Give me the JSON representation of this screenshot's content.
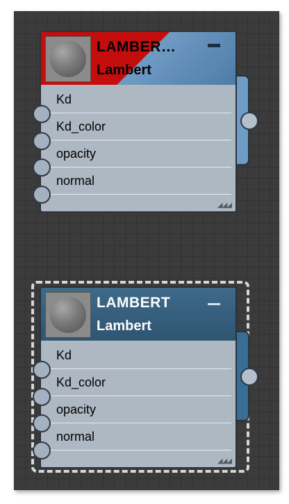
{
  "nodes": [
    {
      "title": "LAMBER…",
      "subtitle": "Lambert",
      "inputs": [
        "Kd",
        "Kd_color",
        "opacity",
        "normal"
      ],
      "selected": false,
      "header_color": "#c40d0d"
    },
    {
      "title": "LAMBERT",
      "subtitle": "Lambert",
      "inputs": [
        "Kd",
        "Kd_color",
        "opacity",
        "normal"
      ],
      "selected": true,
      "header_color": "#2e5572"
    }
  ],
  "colors": {
    "canvas": "#3b3b3b",
    "node_body": "#aeb8c2",
    "port": "#a3b1c0"
  },
  "icons": {
    "collapse": "minus-icon",
    "resize": "resize-grip-icon",
    "preview": "material-sphere-preview"
  }
}
